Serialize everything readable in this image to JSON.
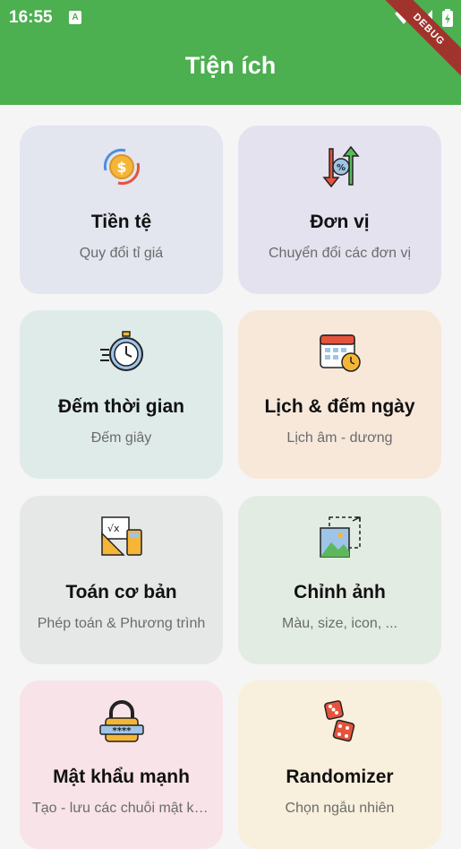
{
  "status_bar": {
    "time": "16:55",
    "notification_letter": "A"
  },
  "debug_banner": "DEBUG",
  "app_bar": {
    "title": "Tiện ích"
  },
  "cards": [
    {
      "title": "Tiền tệ",
      "subtitle": "Quy đổi tỉ giá",
      "icon": "currency-exchange-icon",
      "color": "#e3e5ef"
    },
    {
      "title": "Đơn vị",
      "subtitle": "Chuyển đổi các đơn vị",
      "icon": "unit-conversion-icon",
      "color": "#e5e2f0"
    },
    {
      "title": "Đếm thời gian",
      "subtitle": "Đếm giây",
      "icon": "stopwatch-icon",
      "color": "#dfebe9"
    },
    {
      "title": "Lịch & đếm ngày",
      "subtitle": "Lịch âm - dương",
      "icon": "calendar-icon",
      "color": "#f7e8da"
    },
    {
      "title": "Toán cơ bản",
      "subtitle": "Phép toán & Phương trình",
      "icon": "math-tools-icon",
      "color": "#e6e8e8"
    },
    {
      "title": "Chỉnh ảnh",
      "subtitle": "Màu, size, icon, ...",
      "icon": "image-edit-icon",
      "color": "#e3ece3"
    },
    {
      "title": "Mật khẩu mạnh",
      "subtitle": "Tạo - lưu các chuỗi mật khẩu",
      "icon": "password-lock-icon",
      "color": "#f7e3e8"
    },
    {
      "title": "Randomizer",
      "subtitle": "Chọn ngẫu nhiên",
      "icon": "dice-icon",
      "color": "#f8f0dc"
    }
  ]
}
